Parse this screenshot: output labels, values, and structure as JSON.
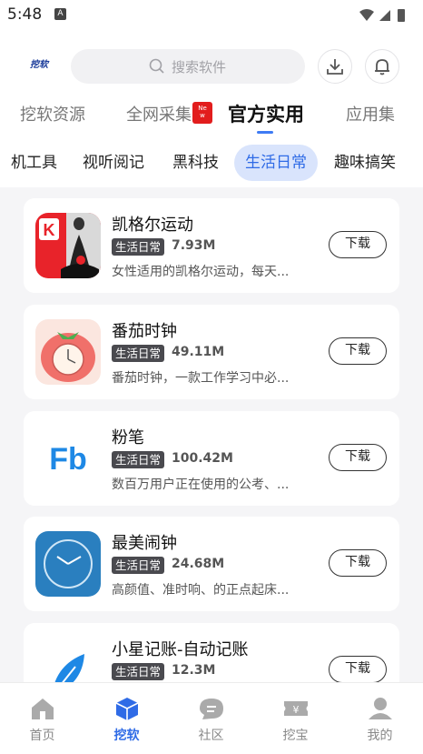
{
  "status_bar": {
    "time": "5:48",
    "notification_badge": "A"
  },
  "header": {
    "logo": "挖软",
    "search": {
      "placeholder": "搜索软件"
    },
    "tabs": [
      {
        "label": "挖软资源"
      },
      {
        "label": "全网采集"
      },
      {
        "label": "官方实用",
        "active": true
      },
      {
        "label": "应用集"
      }
    ],
    "new_badge": {
      "line1": "Ne",
      "line2": "w"
    }
  },
  "categories": [
    {
      "label": "机工具"
    },
    {
      "label": "视听阅记"
    },
    {
      "label": "黑科技"
    },
    {
      "label": "生活日常",
      "active": true
    },
    {
      "label": "趣味搞笑"
    }
  ],
  "apps": [
    {
      "name": "凯格尔运动",
      "tag": "生活日常",
      "size": "7.93M",
      "desc": "女性适用的凯格尔运动，每天...",
      "button": "下载",
      "icon": "kegel-app-icon"
    },
    {
      "name": "番茄时钟",
      "tag": "生活日常",
      "size": "49.11M",
      "desc": "番茄时钟，一款工作学习中必...",
      "button": "下载",
      "icon": "tomato-clock-icon"
    },
    {
      "name": "粉笔",
      "tag": "生活日常",
      "size": "100.42M",
      "desc": "数百万用户正在使用的公考、...",
      "button": "下载",
      "icon": "fenbi-logo-icon"
    },
    {
      "name": "最美闹钟",
      "tag": "生活日常",
      "size": "24.68M",
      "desc": "高颜值、准时响、的正点起床...",
      "button": "下载",
      "icon": "alarm-clock-icon"
    },
    {
      "name": "小星记账-自动记账",
      "tag": "生活日常",
      "size": "12.3M",
      "desc": "",
      "button": "下载",
      "icon": "leaf-icon"
    }
  ],
  "bottom_nav": [
    {
      "label": "首页",
      "icon": "home-icon"
    },
    {
      "label": "挖软",
      "icon": "cube-icon",
      "active": true
    },
    {
      "label": "社区",
      "icon": "chat-bubble-icon"
    },
    {
      "label": "挖宝",
      "icon": "ticket-icon"
    },
    {
      "label": "我的",
      "icon": "profile-icon"
    }
  ],
  "colors": {
    "accent": "#2f6be6",
    "chip_active_bg": "#d9e4fc",
    "new_badge": "#e21d1d",
    "tag_bg": "#4a4a4f"
  }
}
